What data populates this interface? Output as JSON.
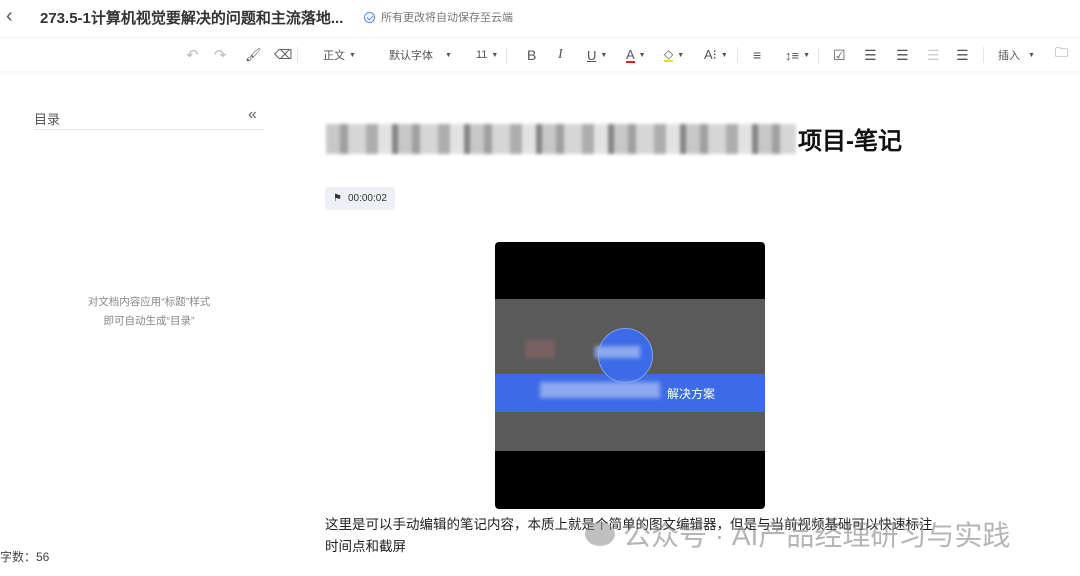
{
  "header": {
    "title": "273.5-1计算机视觉要解决的问题和主流落地...",
    "save_status": "所有更改将自动保存至云端"
  },
  "toolbar": {
    "style": "正文",
    "font": "默认字体",
    "size": "11",
    "bold": "B",
    "italic": "I",
    "underline": "U",
    "font_color": "A",
    "font_size_adjust": "A⁝",
    "insert": "插入",
    "font_color_hex": "#e02020",
    "highlight_hex": "#f5d90a"
  },
  "toc": {
    "label": "目录",
    "collapse": "«",
    "empty_line1": "对文档内容应用“标题”样式",
    "empty_line2": "即可自动生成“目录”"
  },
  "document": {
    "heading_visible": "项目-笔记",
    "timestamp": "00:00:02",
    "video_caption": "解决方案",
    "paragraph": "这里是可以手动编辑的笔记内容，本质上就是个简单的图文编辑器，但是与当前视频基础可以快速标注时间点和截屏"
  },
  "footer": {
    "word_count": "字数：56"
  },
  "watermark": "公众号 · AI产品经理研习与实践"
}
